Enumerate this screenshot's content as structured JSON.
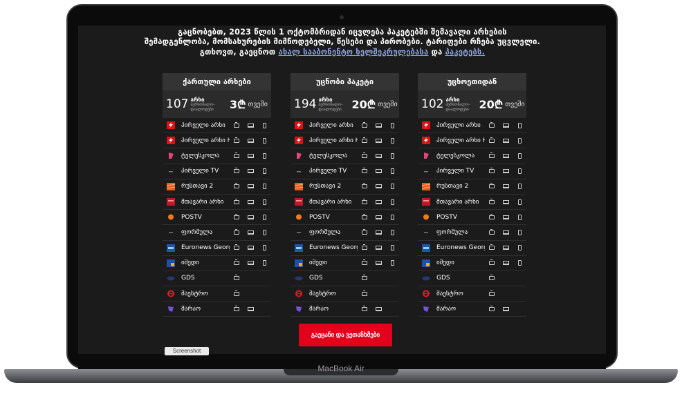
{
  "device": {
    "model_label": "MacBook Air"
  },
  "notice": {
    "line1": "გაცნობებთ, 2023 წლის 1 ოქტომბრიდან იცვლება პაკეტებში შემავალი არხების",
    "line2": "შემადგენლობა, მომსახურების მიმწოდებელი, წესები და პირობები. ტარიფები რჩება უცვლელი.",
    "line3_prefix": "გთხოვთ, გაეცნოთ ",
    "link1": "ახალ სააბონენტო ხელშეკრულებასა",
    "line3_mid": " და ",
    "link2": "პაკეტებს."
  },
  "packages": [
    {
      "title": "ქართული არხები",
      "count": "107",
      "unit": "არხი",
      "unit_sub": "პერსონალო-დაალოდები",
      "price": "3₾",
      "period": "თვეში"
    },
    {
      "title": "უცნობი პაკეტი",
      "count": "194",
      "unit": "არხი",
      "unit_sub": "პერსონალო-დაალოდები",
      "price": "20₾",
      "period": "თვეში"
    },
    {
      "title": "უცხოეთიდან",
      "count": "102",
      "unit": "არხი",
      "unit_sub": "პერსონალო-დაალოდები",
      "price": "20₾",
      "period": "თვეში"
    }
  ],
  "channels": [
    {
      "name": "პირველი არხი",
      "logo": "flash-red",
      "devices": [
        "tv",
        "laptop",
        "phone"
      ]
    },
    {
      "name": "პირველი არხი HD",
      "logo": "flash-red",
      "devices": [
        "tv",
        "laptop",
        "phone"
      ]
    },
    {
      "name": "ტელესკოლა",
      "logo": "flag-pink",
      "devices": [
        "tv",
        "laptop",
        "phone"
      ]
    },
    {
      "name": "პირველი TV",
      "logo": "dash-dark",
      "devices": [
        "tv",
        "laptop",
        "phone"
      ]
    },
    {
      "name": "რუსთავი 2",
      "logo": "stripes-orange",
      "devices": [
        "tv",
        "laptop",
        "phone"
      ]
    },
    {
      "name": "მთავარი არხი",
      "logo": "box-red",
      "devices": [
        "tv",
        "laptop",
        "phone"
      ]
    },
    {
      "name": "POSTV",
      "logo": "dot-orange",
      "devices": [
        "tv",
        "laptop",
        "phone"
      ]
    },
    {
      "name": "ფორმულა",
      "logo": "dash-dark",
      "devices": [
        "tv",
        "laptop",
        "phone"
      ]
    },
    {
      "name": "Euronews Georgia",
      "logo": "box-blue",
      "devices": [
        "tv",
        "laptop",
        "phone"
      ]
    },
    {
      "name": "იმედი",
      "logo": "box-amber",
      "devices": [
        "tv",
        "laptop",
        "phone"
      ]
    },
    {
      "name": "GDS",
      "logo": "oval-blue",
      "devices": [
        "tv"
      ]
    },
    {
      "name": "მაესტრო",
      "logo": "ring-red",
      "devices": [
        "tv"
      ]
    },
    {
      "name": "მარაო",
      "logo": "diamond-purple",
      "devices": [
        "tv",
        "laptop"
      ]
    }
  ],
  "cta": {
    "label": "გაეცანი და ვეთანხმები"
  },
  "screenshot_button": {
    "label": "Screenshot"
  },
  "colors": {
    "accent": "#e3001b",
    "screen_bg": "#1b1b1b",
    "header_bg": "#343434",
    "link": "#8aa0d8"
  }
}
